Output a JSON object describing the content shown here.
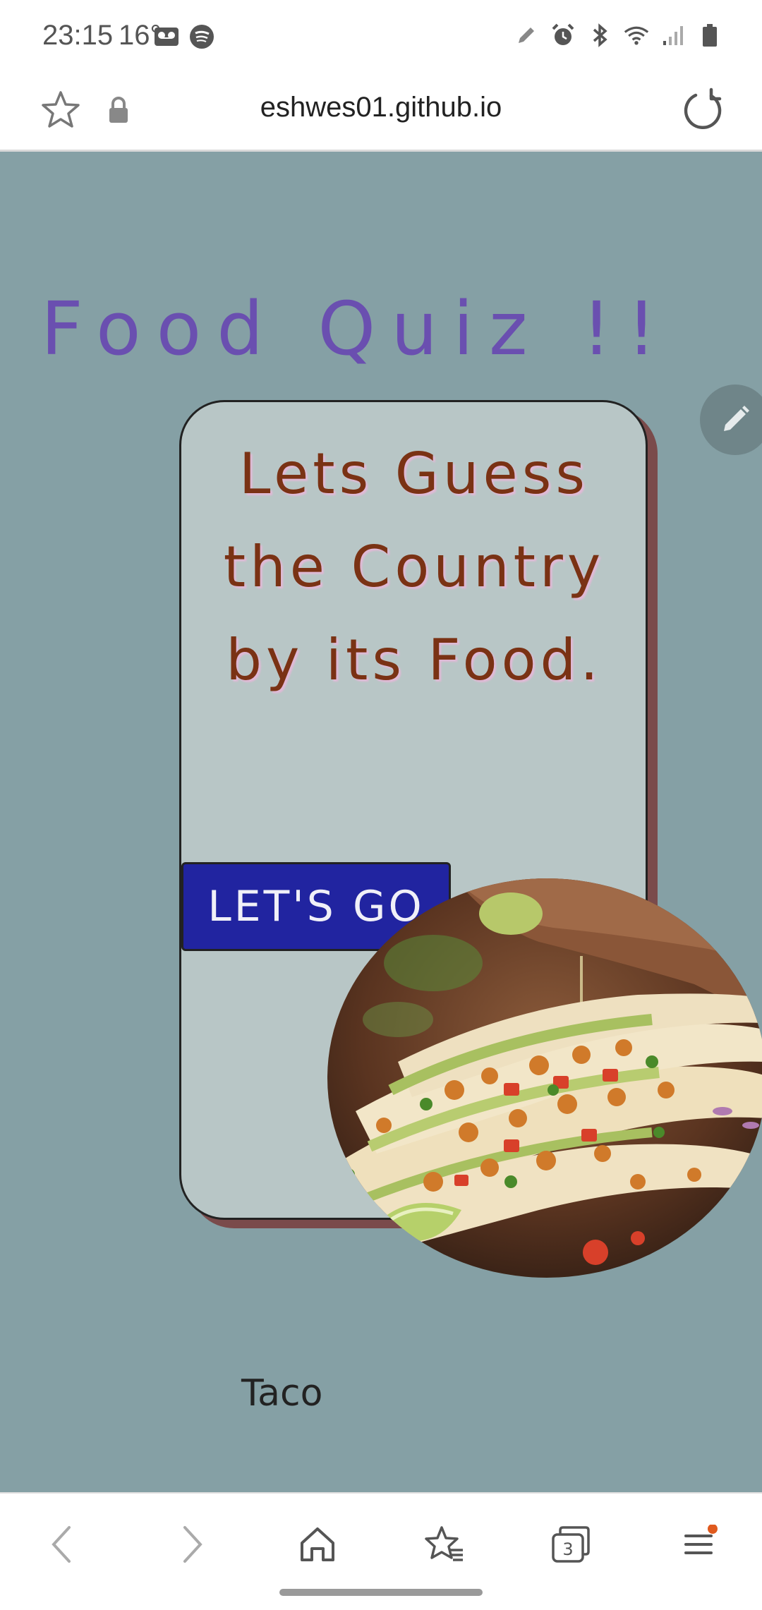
{
  "status_bar": {
    "time": "23:15",
    "temperature": "16°"
  },
  "browser": {
    "url": "eshwes01.github.io"
  },
  "page": {
    "title": "Food Quiz !!",
    "card_text": "Lets Guess the Country by its Food.",
    "button_label": "LET'S GO",
    "caption": "Taco"
  },
  "bottom_nav": {
    "tabs_count": "3"
  },
  "colors": {
    "page_background": "#85a0a5",
    "title_color": "#6a4fb0",
    "card_background": "#b8c6c6",
    "card_text_color": "#7a3214",
    "button_color": "#2124a0",
    "notification_dot": "#e05a1e"
  },
  "icons": [
    "voicemail-icon",
    "spotify-icon",
    "pencil-icon",
    "alarm-icon",
    "bluetooth-icon",
    "wifi-icon",
    "signal-icon",
    "battery-icon",
    "star-icon",
    "lock-icon",
    "reload-icon",
    "edit-icon",
    "back-arrow-icon",
    "forward-arrow-icon",
    "home-icon",
    "bookmarks-icon",
    "tabs-icon",
    "menu-icon"
  ]
}
